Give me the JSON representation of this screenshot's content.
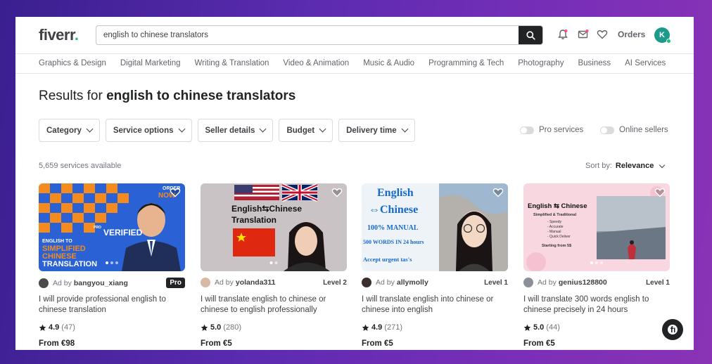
{
  "logo": {
    "text": "fiverr",
    "dot": "."
  },
  "search": {
    "value": "english to chinese translators"
  },
  "header": {
    "orders_label": "Orders",
    "avatar_letter": "K"
  },
  "categories": [
    "Graphics & Design",
    "Digital Marketing",
    "Writing & Translation",
    "Video & Animation",
    "Music & Audio",
    "Programming & Tech",
    "Photography",
    "Business",
    "AI Services"
  ],
  "results": {
    "prefix": "Results for ",
    "query": "english to chinese translators"
  },
  "filters": [
    "Category",
    "Service options",
    "Seller details",
    "Budget",
    "Delivery time"
  ],
  "toggles": {
    "pro": "Pro services",
    "online": "Online sellers"
  },
  "count": "5,659 services available",
  "sort": {
    "label": "Sort by:",
    "value": "Relevance"
  },
  "gigs": [
    {
      "ad_by": "Ad by",
      "seller": "bangyou_xiang",
      "badge": "Pro",
      "title": "I will provide professional english to chinese translation",
      "rating": "4.9",
      "reviews": "(47)",
      "price": "From €98",
      "thumb": {
        "order": "ORDER",
        "now": "NOW",
        "verified": "VERIFIED",
        "pro": "PRO",
        "line1": "ENGLISH TO",
        "line2": "SIMPLIFIED",
        "line3": "CHINESE",
        "line4": "TRANSLATION"
      }
    },
    {
      "ad_by": "Ad by",
      "seller": "yolanda311",
      "badge": "Level 2",
      "title": "I will translate english to chinese or chinese to english professionally",
      "rating": "5.0",
      "reviews": "(280)",
      "price": "From €5",
      "thumb": {
        "line1": "English⇆Chinese",
        "line2": "Translation"
      }
    },
    {
      "ad_by": "Ad by",
      "seller": "allymolly",
      "badge": "Level 1",
      "title": "I will translate english into chinese or chinese into english",
      "rating": "4.9",
      "reviews": "(271)",
      "price": "From €5",
      "thumb": {
        "line1": "English",
        "line2": "⇔Chinese",
        "line3": "100% MANUAL",
        "line4": "500 WORDS IN 24 hours",
        "line5": "Accept urgent tas's"
      }
    },
    {
      "ad_by": "Ad by",
      "seller": "genius128800",
      "badge": "Level 1",
      "title": "I will translate 300 words english to chinese precisely in 24 hours",
      "rating": "5.0",
      "reviews": "(44)",
      "price": "From €5",
      "thumb": {
        "line1": "English ⇆ Chinese",
        "line2": "Simplified & Traditional",
        "bullets": [
          "- Speedy",
          "- Accurate",
          "- Manual",
          "- Quick Deliver"
        ],
        "starting": "Starting from 5$"
      }
    }
  ],
  "colors": {
    "brand_green": "#1dbf73",
    "text_dark": "#222325",
    "text_muted": "#74767e"
  }
}
